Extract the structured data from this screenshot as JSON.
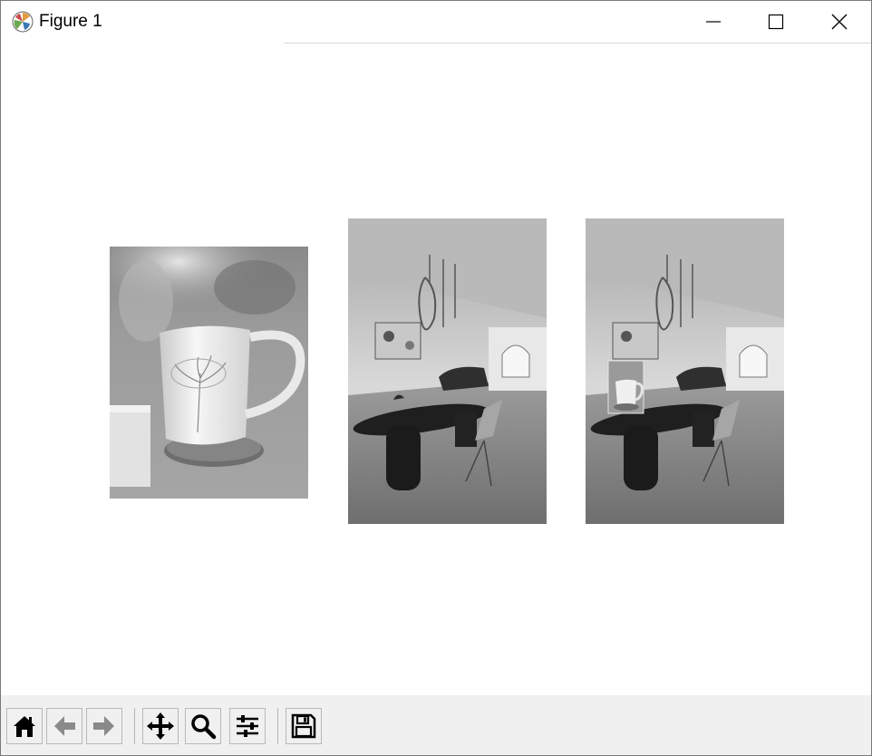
{
  "window": {
    "title": "Figure 1"
  },
  "title_buttons": {
    "minimize": "minimize",
    "maximize": "maximize",
    "close": "close"
  },
  "figure": {
    "panels": [
      {
        "name": "mug-photo",
        "description_kind": "grayscale mug image"
      },
      {
        "name": "room-photo",
        "description_kind": "grayscale interior image"
      },
      {
        "name": "room-with-inset",
        "description_kind": "grayscale interior with inset mug"
      }
    ]
  },
  "toolbar": {
    "buttons": [
      {
        "icon": "home-icon"
      },
      {
        "icon": "back-arrow-icon"
      },
      {
        "icon": "forward-arrow-icon"
      },
      {
        "icon": "pan-move-icon"
      },
      {
        "icon": "zoom-magnifier-icon"
      },
      {
        "icon": "configure-subplots-icon"
      },
      {
        "icon": "save-disk-icon"
      }
    ]
  }
}
